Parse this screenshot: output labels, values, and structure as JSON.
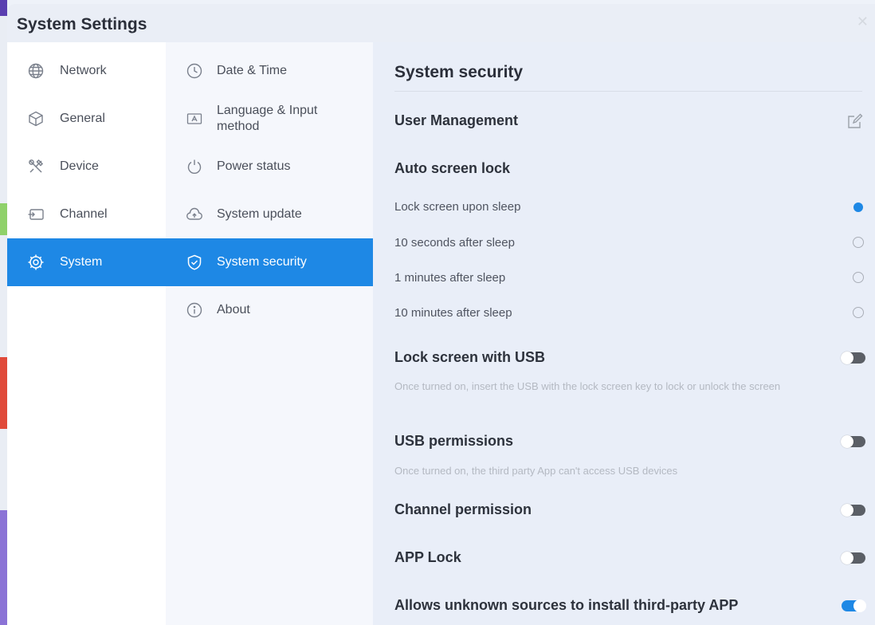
{
  "window": {
    "title": "System Settings"
  },
  "sidebar": {
    "items": [
      {
        "label": "Network",
        "icon": "globe-icon"
      },
      {
        "label": "General",
        "icon": "cube-icon"
      },
      {
        "label": "Device",
        "icon": "tools-icon"
      },
      {
        "label": "Channel",
        "icon": "input-source-icon"
      },
      {
        "label": "System",
        "icon": "gear-icon",
        "active": true
      }
    ]
  },
  "submenu": {
    "items": [
      {
        "label": "Date & Time",
        "icon": "clock-icon"
      },
      {
        "label": "Language & Input method",
        "icon": "keyboard-icon"
      },
      {
        "label": "Power status",
        "icon": "power-icon"
      },
      {
        "label": "System update",
        "icon": "cloud-upload-icon"
      },
      {
        "label": "System security",
        "icon": "shield-check-icon",
        "active": true
      },
      {
        "label": "About",
        "icon": "info-icon"
      }
    ]
  },
  "content": {
    "title": "System security",
    "user_management": {
      "label": "User Management"
    },
    "auto_lock": {
      "label": "Auto screen lock",
      "options": [
        {
          "label": "Lock screen upon sleep",
          "selected": true
        },
        {
          "label": "10 seconds after sleep",
          "selected": false
        },
        {
          "label": "1 minutes after sleep",
          "selected": false
        },
        {
          "label": "10 minutes after sleep",
          "selected": false
        }
      ]
    },
    "usb_lock": {
      "label": "Lock screen with USB",
      "description": "Once turned on, insert the USB with the lock screen key to lock or unlock the screen",
      "enabled": false
    },
    "usb_permissions": {
      "label": "USB permissions",
      "description": "Once turned on, the third party App can't access USB devices",
      "enabled": false
    },
    "channel_permission": {
      "label": "Channel permission",
      "enabled": false
    },
    "app_lock": {
      "label": "APP Lock",
      "enabled": false
    },
    "unknown_sources": {
      "label": "Allows unknown sources to install third-party APP",
      "enabled": true
    }
  },
  "colors": {
    "accent": "#1e88e5",
    "background": "#eef2f9",
    "toggle_off": "#5b5f66"
  }
}
